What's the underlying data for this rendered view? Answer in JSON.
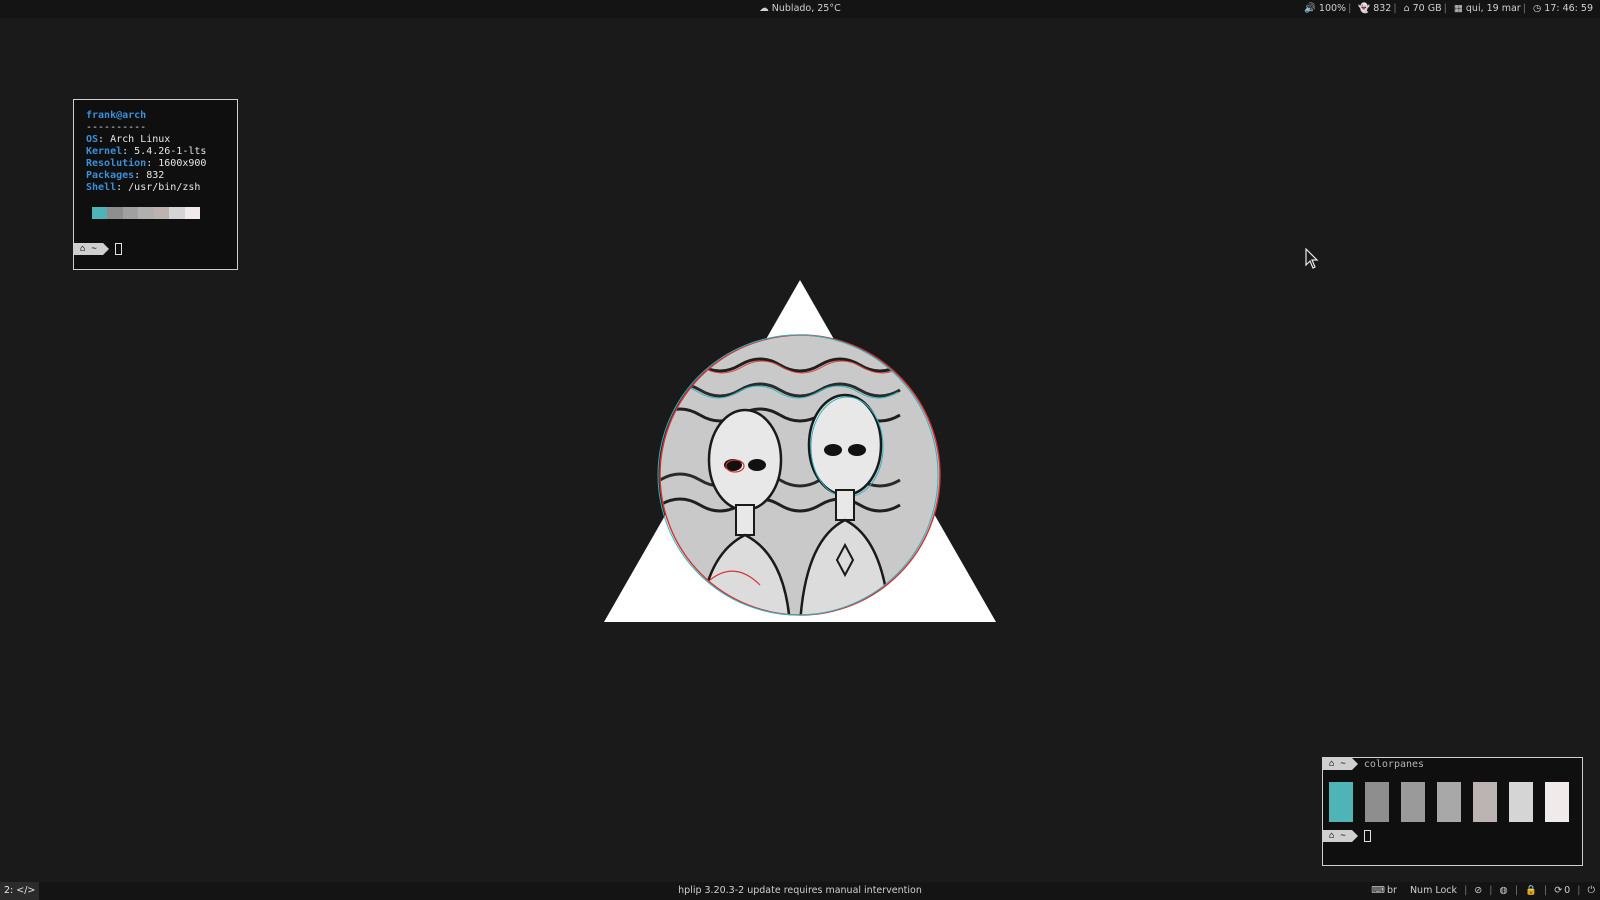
{
  "topbar": {
    "weather": "Nublado, 25°C",
    "volume": "100%",
    "packages": "832",
    "disk": "70 GB",
    "date": "qui, 19 mar",
    "time": "17: 46: 59"
  },
  "neofetch": {
    "user_host": "frank@arch",
    "separator": "----------",
    "fields": [
      {
        "key": "OS",
        "value": ": Arch Linux"
      },
      {
        "key": "Kernel",
        "value": ": 5.4.26-1-lts"
      },
      {
        "key": "Resolution",
        "value": ": 1600x900"
      },
      {
        "key": "Packages",
        "value": ": 832"
      },
      {
        "key": "Shell",
        "value": ": /usr/bin/zsh"
      }
    ],
    "palette": [
      "#4fb4b5",
      "#8e8e8e",
      "#a1a1a1",
      "#b0b0b0",
      "#bcb3b3",
      "#d5d5d5",
      "#f0eaea"
    ]
  },
  "prompt": {
    "home_icon": "home-icon",
    "dir": "~"
  },
  "colorpanes_terminal": {
    "command": "colorpanes",
    "panes": [
      "#4fb4b5",
      "#8e8e8e",
      "#9a9a9a",
      "#a8a8a8",
      "#bcb3b3",
      "#d5d5d5",
      "#f0eaea"
    ]
  },
  "bottombar": {
    "workspace": "2: </>",
    "notification": "hplip 3.20.3-2 update requires manual intervention",
    "keyboard_layout": "br",
    "numlock": "Num Lock",
    "updates": "0"
  }
}
